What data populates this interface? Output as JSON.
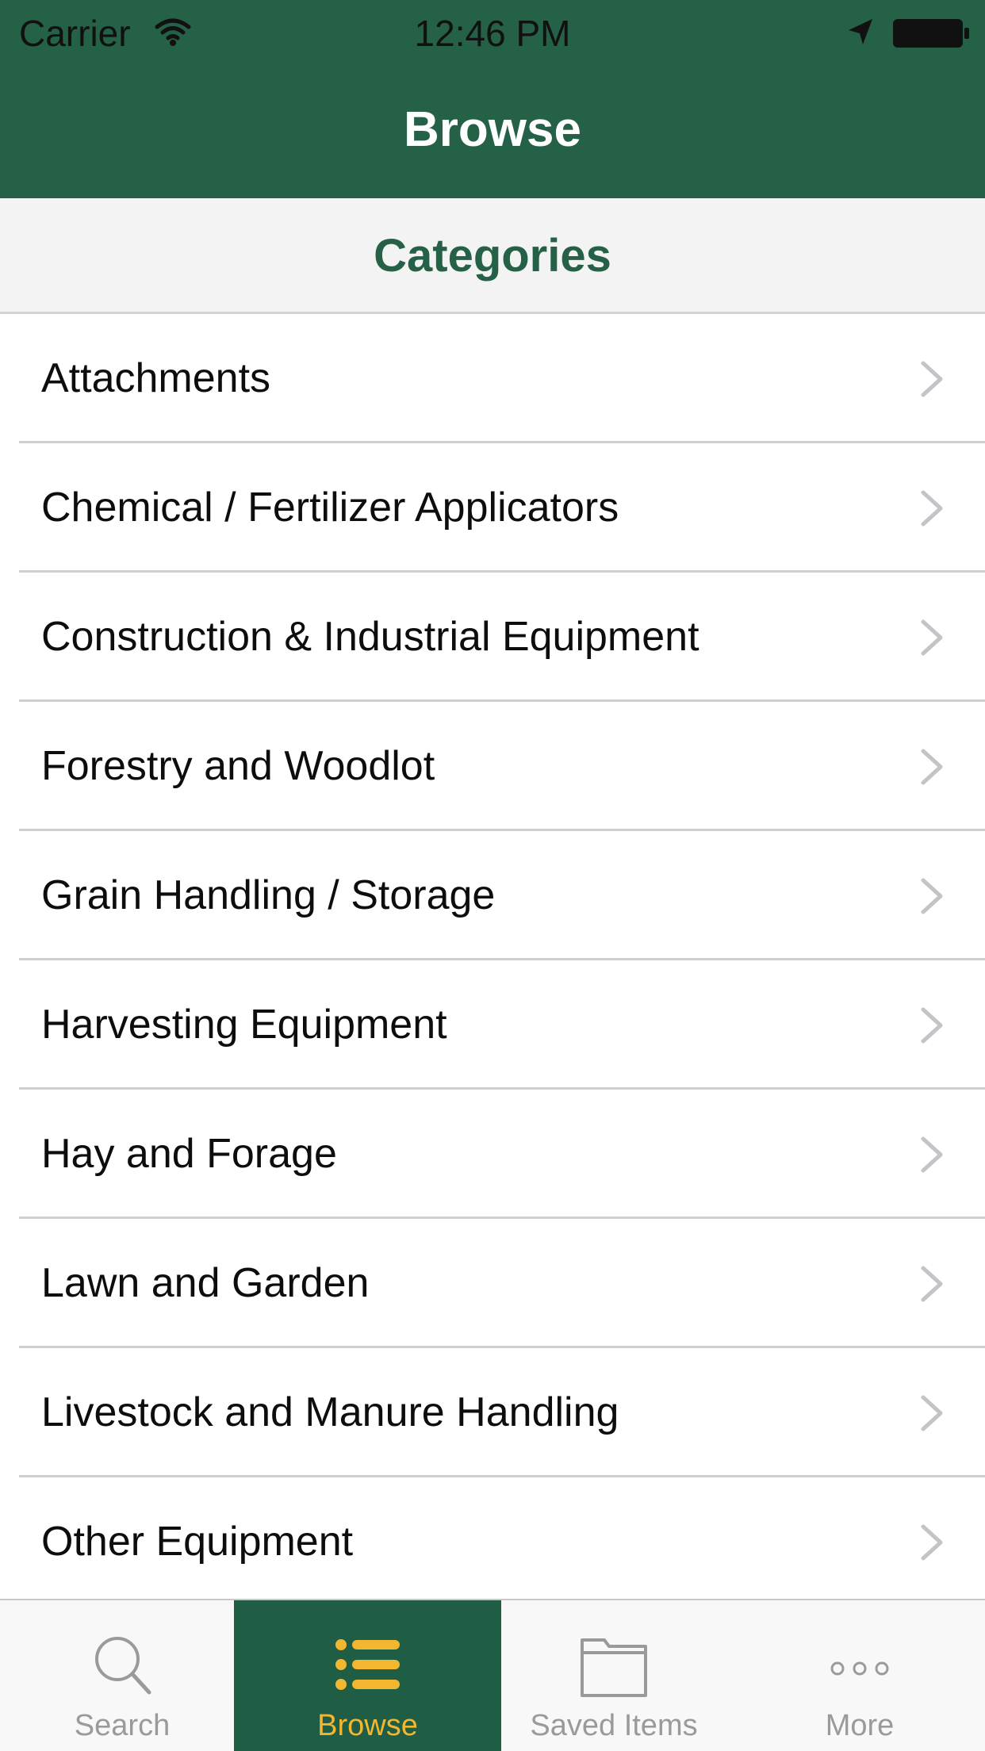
{
  "status_bar": {
    "carrier": "Carrier",
    "time": "12:46 PM"
  },
  "nav": {
    "title": "Browse"
  },
  "section": {
    "title": "Categories"
  },
  "categories": [
    "Attachments",
    "Chemical / Fertilizer Applicators",
    "Construction & Industrial Equipment",
    "Forestry and Woodlot",
    "Grain Handling / Storage",
    "Harvesting Equipment",
    "Hay and Forage",
    "Lawn and Garden",
    "Livestock and Manure Handling",
    "Other Equipment"
  ],
  "tabbar": {
    "tabs": [
      {
        "label": "Search",
        "icon": "search-icon",
        "active": false
      },
      {
        "label": "Browse",
        "icon": "list-icon",
        "active": true
      },
      {
        "label": "Saved Items",
        "icon": "folder-icon",
        "active": false
      },
      {
        "label": "More",
        "icon": "more-icon",
        "active": false
      }
    ]
  },
  "colors": {
    "brand_green": "#256146",
    "active_tab_green": "#1f5e44",
    "accent_yellow": "#f2b631",
    "section_bg": "#f3f3f3"
  }
}
